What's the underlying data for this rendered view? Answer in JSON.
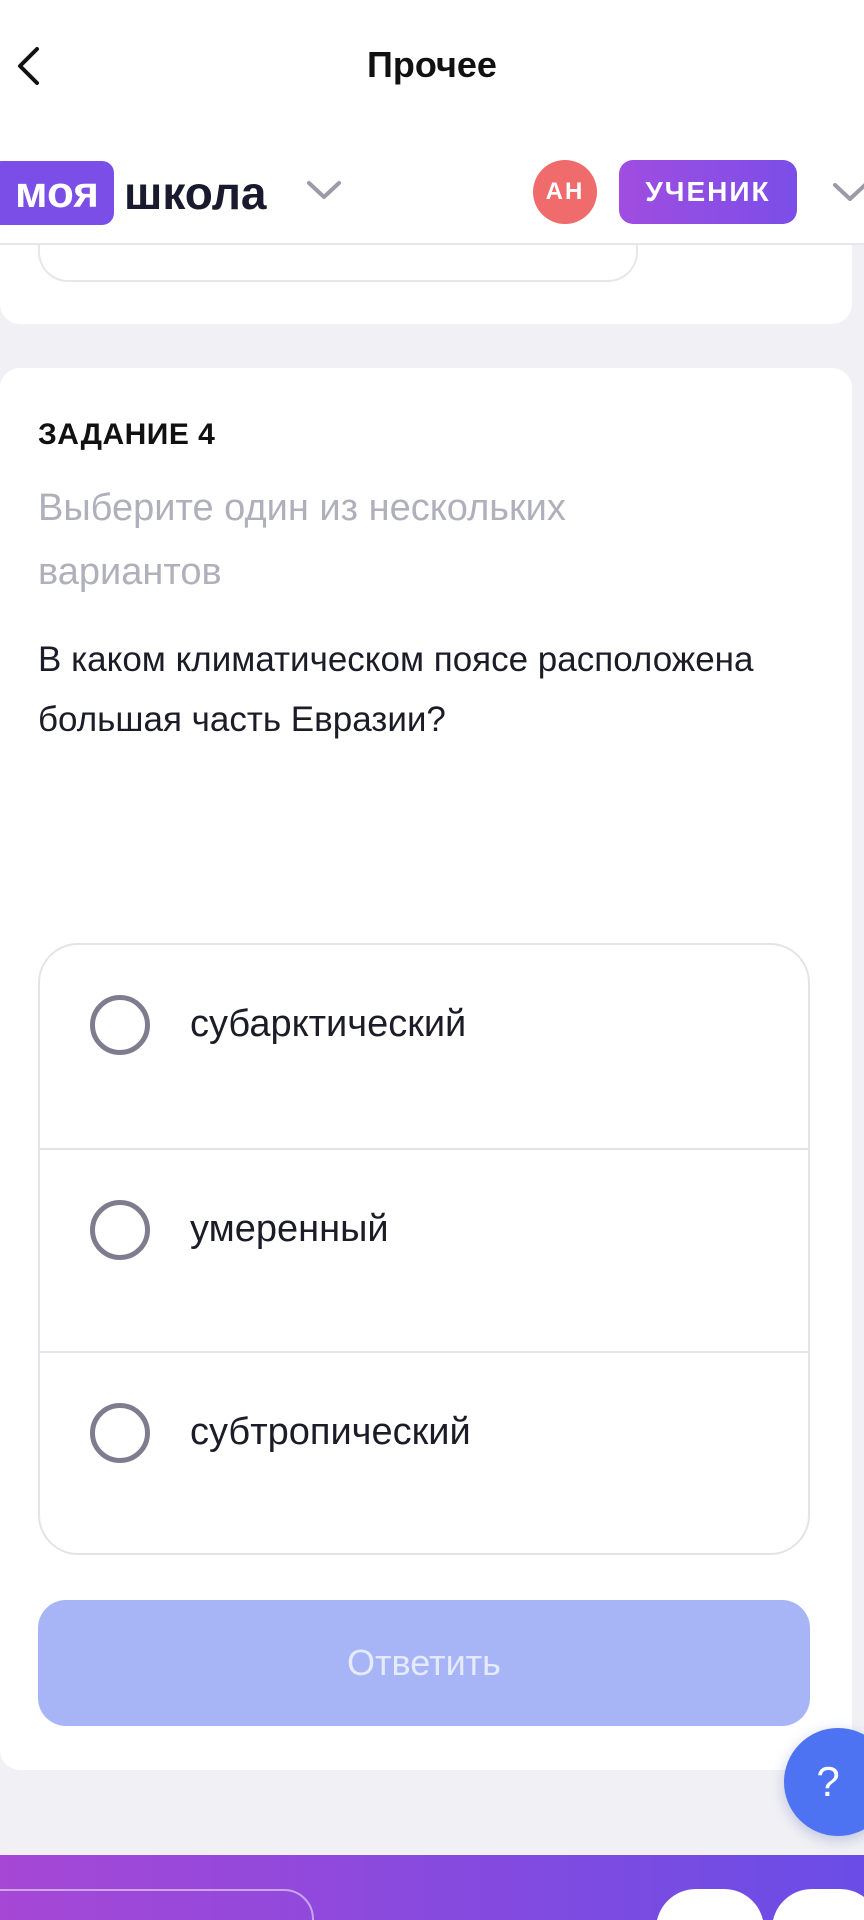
{
  "nav": {
    "title": "Прочее"
  },
  "header": {
    "logo_part1": "моя",
    "logo_part2": "школа",
    "avatar_initials": "АН",
    "role_label": "УЧЕНИК"
  },
  "task": {
    "label": "ЗАДАНИЕ 4",
    "hint": "Выберите один из нескольких вариантов",
    "question": "В каком климатическом поясе расположена большая часть Евразии?",
    "options": [
      {
        "label": "субарктический",
        "selected": false
      },
      {
        "label": "умеренный",
        "selected": false
      },
      {
        "label": "субтропический",
        "selected": false
      }
    ],
    "answer_button": "Ответить"
  },
  "help": {
    "label": "?"
  },
  "colors": {
    "brand_purple": "#7b4ee8",
    "avatar_red": "#f06b6b",
    "button_disabled": "#a7b5f7",
    "help_blue": "#4d73f2"
  }
}
